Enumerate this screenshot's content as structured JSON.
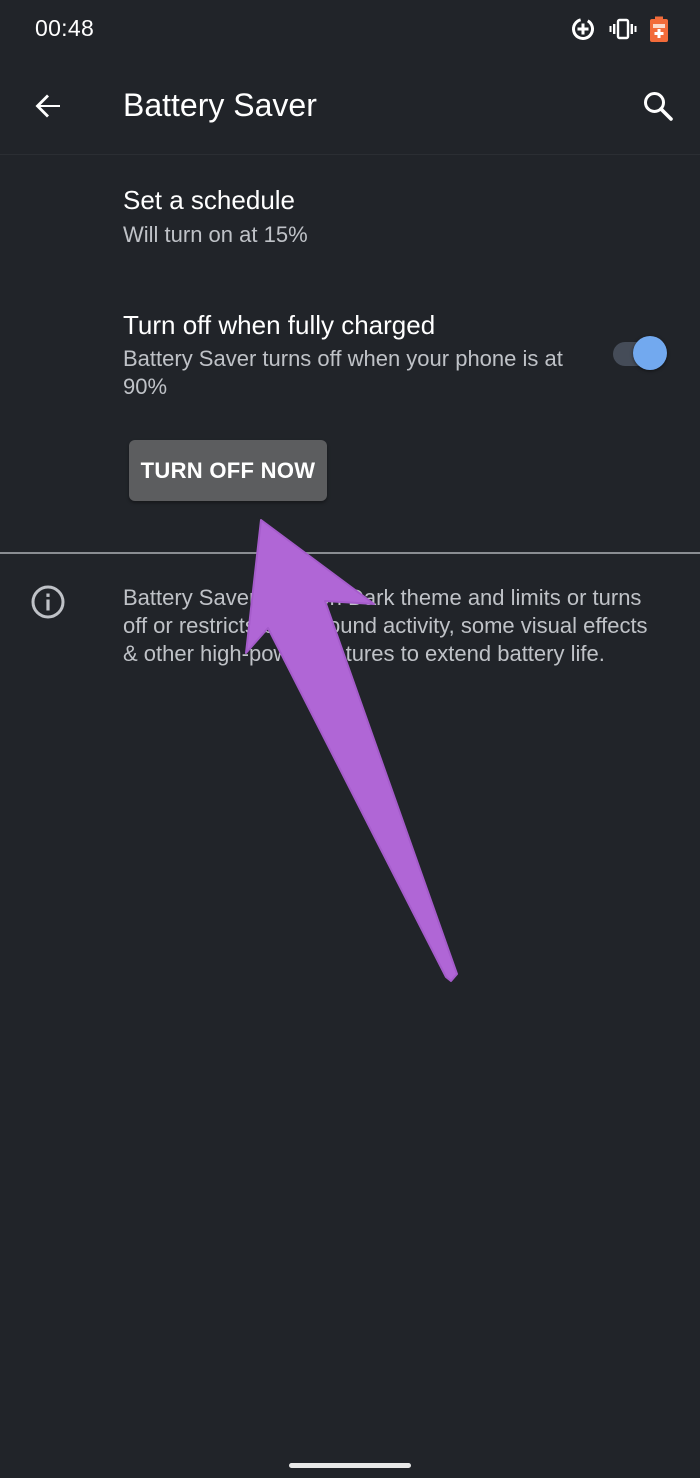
{
  "status_bar": {
    "time": "00:48",
    "icons": [
      "data-saver-icon",
      "vibrate-icon",
      "battery-saver-icon"
    ]
  },
  "app_bar": {
    "title": "Battery Saver",
    "back_icon": "arrow-back-icon",
    "search_icon": "search-icon"
  },
  "preferences": {
    "schedule": {
      "title": "Set a schedule",
      "summary": "Will turn on at 15%"
    },
    "full_charge": {
      "title": "Turn off when fully charged",
      "summary": "Battery Saver turns off when your phone is at 90%",
      "toggle_on": true
    }
  },
  "action": {
    "turn_off_label": "TURN OFF NOW"
  },
  "footer": {
    "icon": "info-icon",
    "text": "Battery Saver turns on Dark theme and limits or turns off or restricts background activity, some visual effects & other high-power features to extend battery life."
  },
  "colors": {
    "background": "#212429",
    "accent": "#72a9ef",
    "button": "#5c5d5f",
    "annotation_arrow": "#b066d6",
    "battery_saver_orange": "#f26b3a"
  }
}
